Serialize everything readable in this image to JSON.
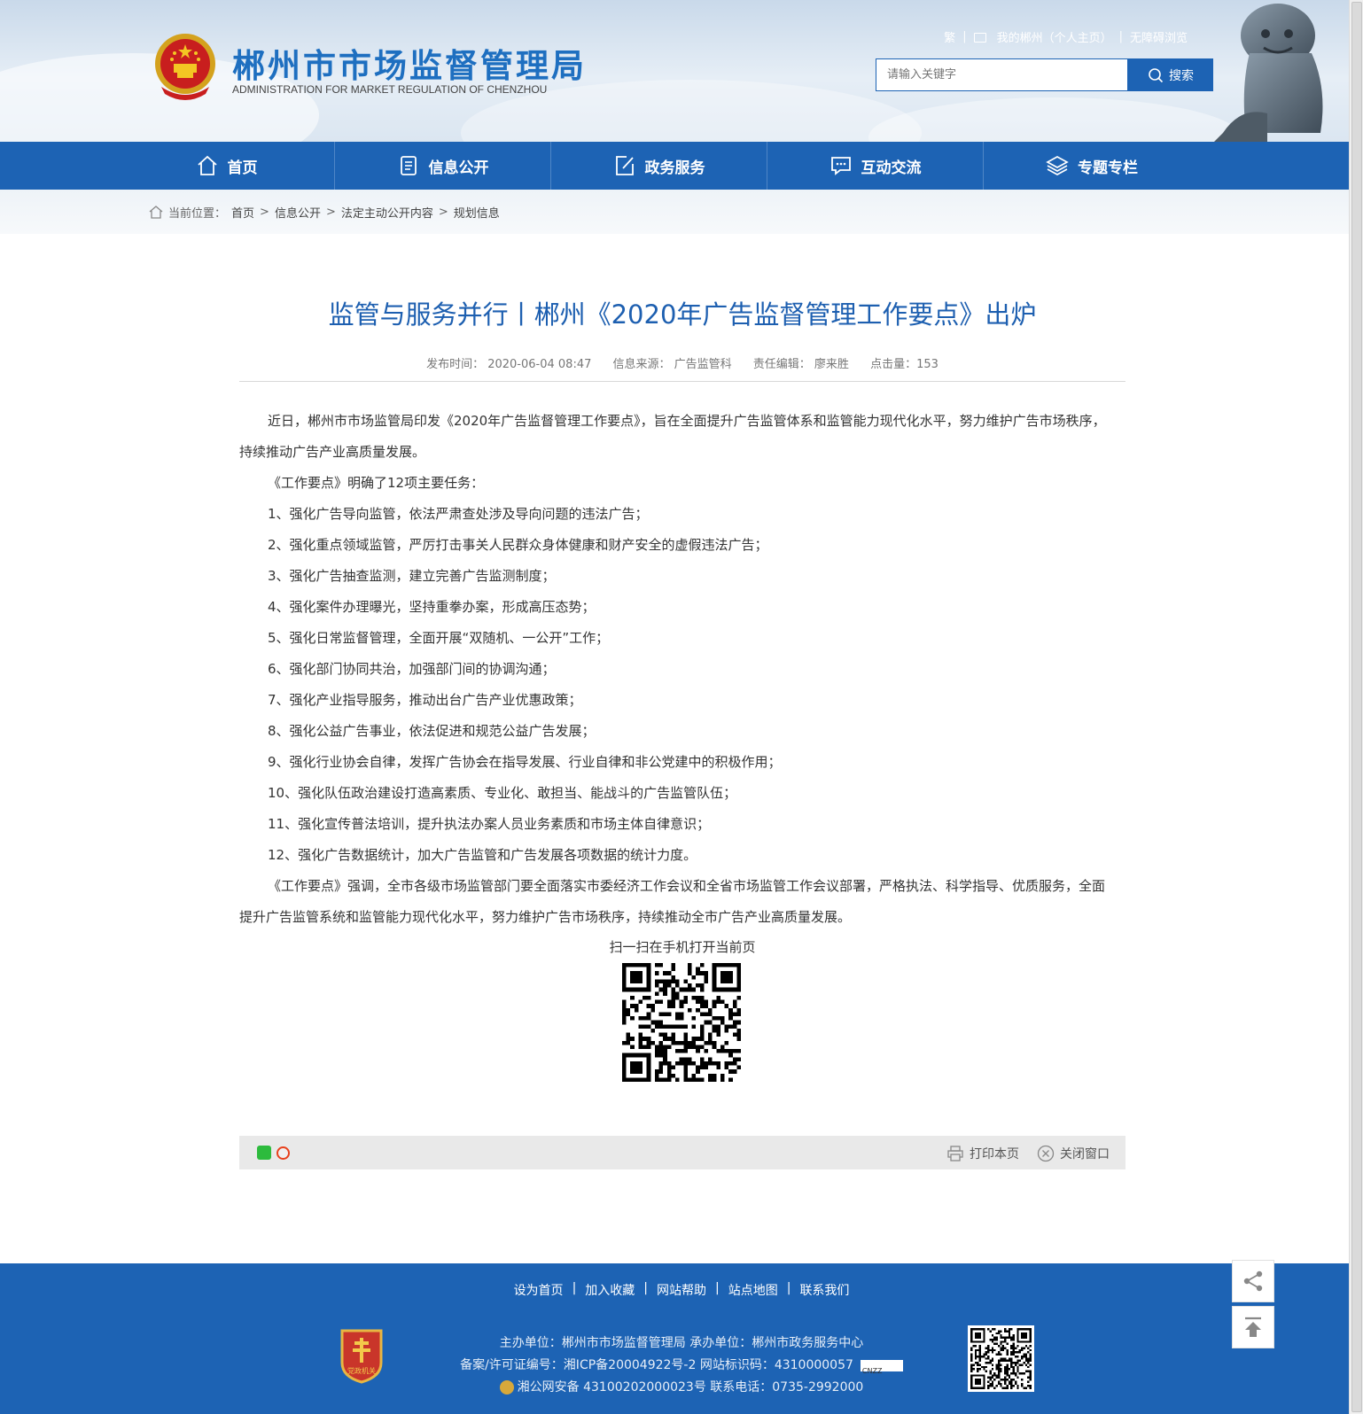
{
  "header": {
    "site_title": "郴州市市场监督管理局",
    "site_subtitle": "ADMINISTRATION FOR MARKET REGULATION OF CHENZHOU",
    "toplinks": {
      "traditional": "繁",
      "my_chenzhou": "我的郴州（个人主页）",
      "accessibility": "无障碍浏览"
    },
    "search": {
      "placeholder": "请输入关键字",
      "button_label": "搜索"
    }
  },
  "nav": {
    "items": [
      {
        "label": "首页",
        "icon": "home-icon"
      },
      {
        "label": "信息公开",
        "icon": "document-icon"
      },
      {
        "label": "政务服务",
        "icon": "edit-icon"
      },
      {
        "label": "互动交流",
        "icon": "chat-icon"
      },
      {
        "label": "专题专栏",
        "icon": "layers-icon"
      }
    ]
  },
  "breadcrumb": {
    "prefix": "当前位置：",
    "items": [
      "首页",
      "信息公开",
      "法定主动公开内容",
      "规划信息"
    ]
  },
  "article": {
    "title": "监管与服务并行丨郴州《2020年广告监督管理工作要点》出炉",
    "meta": {
      "publish_time": "发布时间： 2020-06-04 08:47",
      "source": "信息来源： 广告监管科",
      "editor": "责任编辑： 廖来胜",
      "clicks": "点击量：153"
    },
    "paragraphs": [
      "近日，郴州市市场监管局印发《2020年广告监督管理工作要点》，旨在全面提升广告监管体系和监管能力现代化水平，努力维护广告市场秩序，持续推动广告产业高质量发展。",
      "《工作要点》明确了12项主要任务：",
      "1、强化广告导向监管，依法严肃查处涉及导向问题的违法广告；",
      "2、强化重点领域监管，严厉打击事关人民群众身体健康和财产安全的虚假违法广告；",
      "3、强化广告抽查监测，建立完善广告监测制度；",
      "4、强化案件办理曝光，坚持重拳办案，形成高压态势；",
      "5、强化日常监督管理，全面开展“双随机、一公开”工作；",
      "6、强化部门协同共治，加强部门间的协调沟通；",
      "7、强化产业指导服务，推动出台广告产业优惠政策；",
      "8、强化公益广告事业，依法促进和规范公益广告发展；",
      "9、强化行业协会自律，发挥广告协会在指导发展、行业自律和非公党建中的积极作用；",
      "10、强化队伍政治建设打造高素质、专业化、敢担当、能战斗的广告监管队伍；",
      "11、强化宣传普法培训，提升执法办案人员业务素质和市场主体自律意识；",
      "12、强化广告数据统计，加大广告监管和广告发展各项数据的统计力度。",
      "《工作要点》强调，全市各级市场监管部门要全面落实市委经济工作会议和全省市场监管工作会议部署，严格执法、科学指导、优质服务，全面提升广告监管系统和监管能力现代化水平，努力维护广告市场秩序，持续推动全市广告产业高质量发展。"
    ],
    "qr_caption": "扫一扫在手机打开当前页"
  },
  "sharebar": {
    "print_label": "打印本页",
    "close_label": "关闭窗口"
  },
  "footer": {
    "links": [
      "设为首页",
      "加入收藏",
      "网站帮助",
      "站点地图",
      "联系我们"
    ],
    "line1": "主办单位：郴州市市场监督管理局   承办单位：郴州市政务服务中心",
    "line2": "备案/许可证编号：湘ICP备20004922号-2    网站标识码：4310000057",
    "line3": "湘公网安备 43100202000023号   联系电话：0735-2992000",
    "badge_text": "党政机关"
  },
  "colors": {
    "brand_blue": "#1d63b4",
    "title_blue": "#1d5fb0"
  }
}
